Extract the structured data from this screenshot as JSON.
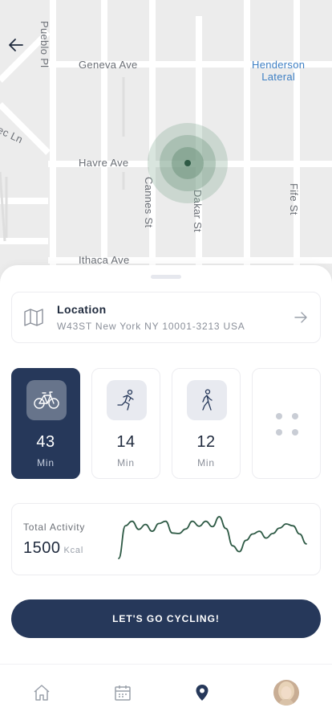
{
  "map": {
    "streets": [
      "Geneva Ave",
      "Havre Ave",
      "Ithaca Ave",
      "Pueblo Pl",
      "Cannes St",
      "Dakar St",
      "Fife St",
      "ec Ln"
    ],
    "water_label_line1": "Henderson",
    "water_label_line2": "Lateral"
  },
  "location": {
    "title": "Location",
    "address": "W43ST New York NY 10001-3213 USA"
  },
  "activities": [
    {
      "icon": "bicycle-icon",
      "value": "43",
      "unit": "Min",
      "active": true
    },
    {
      "icon": "running-icon",
      "value": "14",
      "unit": "Min",
      "active": false
    },
    {
      "icon": "walking-icon",
      "value": "12",
      "unit": "Min",
      "active": false
    },
    {
      "icon": "more-icon",
      "active": false
    }
  ],
  "total_activity": {
    "label": "Total Activity",
    "value": "1500",
    "unit": "Kcal",
    "trend": [
      0,
      72,
      82,
      64,
      75,
      60,
      77,
      82,
      56,
      55,
      65,
      82,
      71,
      82,
      70,
      92,
      66,
      28,
      15,
      40,
      54,
      60,
      45,
      55,
      67,
      76,
      72,
      54,
      32
    ]
  },
  "cta": {
    "label": "LET'S GO CYCLING!"
  },
  "tabbar": [
    "home-icon",
    "calendar-icon",
    "location-pin-icon",
    "profile-avatar"
  ],
  "colors": {
    "primary": "#26385a",
    "accent_green": "#2e5a45",
    "map_bg": "#ececec",
    "water": "#3d7fc4"
  }
}
